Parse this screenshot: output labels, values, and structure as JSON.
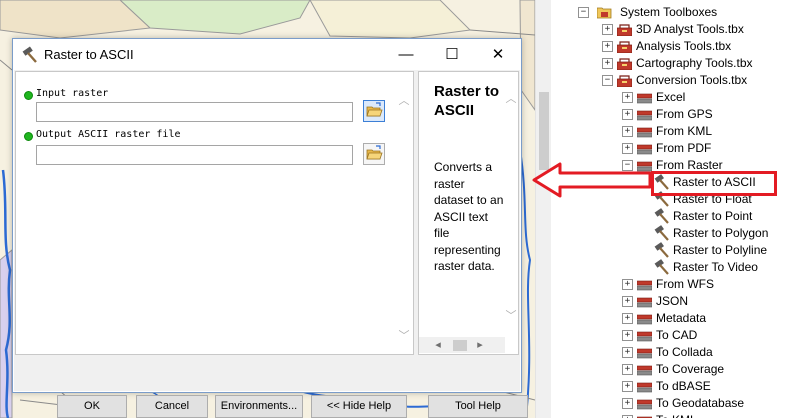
{
  "dialog": {
    "title": "Raster to ASCII",
    "controls": {
      "minimize": "—",
      "maximize": "☐",
      "close": "✕"
    },
    "params": [
      {
        "label": "Input raster",
        "value": ""
      },
      {
        "label": "Output ASCII raster file",
        "value": ""
      }
    ],
    "help": {
      "title": "Raster to ASCII",
      "text": "Converts a raster dataset to an ASCII text file representing raster data."
    },
    "buttons": {
      "ok": "OK",
      "cancel": "Cancel",
      "environments": "Environments...",
      "hide_help": "<< Hide Help",
      "tool_help": "Tool Help"
    }
  },
  "tree": {
    "root": "System Toolboxes",
    "toolboxes": [
      "3D Analyst Tools.tbx",
      "Analysis Tools.tbx",
      "Cartography Tools.tbx",
      "Conversion Tools.tbx"
    ],
    "toolsets_before": [
      "Excel",
      "From GPS",
      "From KML",
      "From PDF",
      "From Raster"
    ],
    "tools": [
      "Raster to ASCII",
      "Raster to Float",
      "Raster to Point",
      "Raster to Polygon",
      "Raster to Polyline",
      "Raster To Video"
    ],
    "toolsets_after": [
      "From WFS",
      "JSON",
      "Metadata",
      "To CAD",
      "To Collada",
      "To Coverage",
      "To dBASE",
      "To Geodatabase",
      "To KML"
    ]
  },
  "colors": {
    "highlight": "#e31b23",
    "dialog_border": "#7a9cc9",
    "required_dot": "#1fb51f"
  }
}
